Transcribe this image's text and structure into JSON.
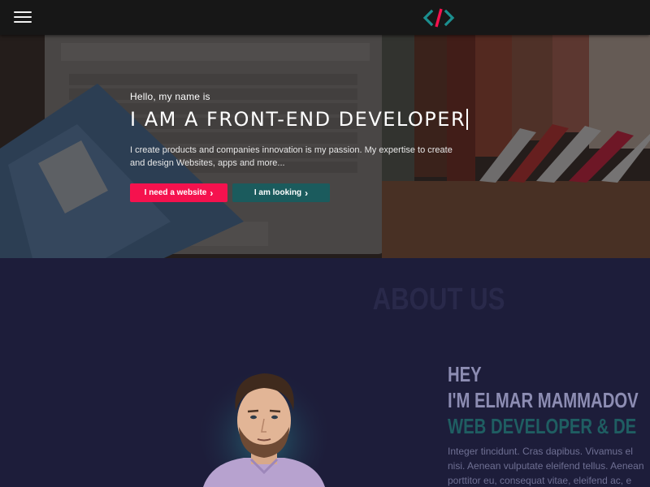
{
  "navbar": {
    "menu_icon": "hamburger-icon",
    "logo_icon": "code-brackets-logo"
  },
  "hero": {
    "greeting": "Hello, my name is",
    "title": "I AM A FRONT-END DEVELOPER",
    "description": "I create products and companies innovation is my passion. My expertise to create and design Websites, apps and more...",
    "buttons": {
      "primary_label": "I need a website",
      "secondary_label": "I am looking"
    }
  },
  "about": {
    "heading": "ABOUT US",
    "intro": {
      "hey": "HEY",
      "name": "I'M ELMAR MAMMADOV",
      "role": "WEB DEVELOPER & DE",
      "text_lines": [
        "Integer tincidunt. Cras dapibus. Vivamus el",
        "nisi. Aenean vulputate eleifend tellus. Aenean",
        "porttitor eu, consequat vitae, eleifend ac, e"
      ]
    }
  },
  "colors": {
    "accent_pink": "#f5124e",
    "accent_teal": "#1b5b5d",
    "about_bg": "#1d1d3a",
    "navbar_bg": "#171717"
  }
}
